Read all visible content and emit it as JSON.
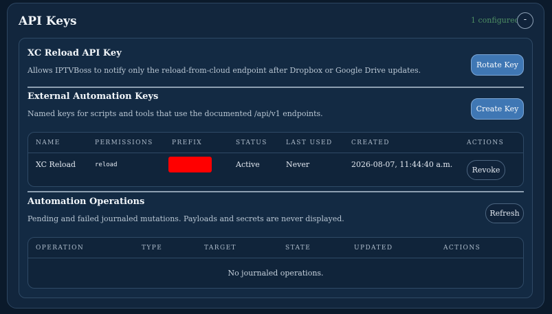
{
  "header": {
    "title": "API Keys",
    "configured_count": "1 configured",
    "collapse_label": "-"
  },
  "reload_section": {
    "title": "XC Reload API Key",
    "description": "Allows IPTVBoss to notify only the reload-from-cloud endpoint after Dropbox or Google Drive updates.",
    "button": "Rotate Key"
  },
  "automation_keys": {
    "title": "External Automation Keys",
    "description": "Named keys for scripts and tools that use the documented /api/v1 endpoints.",
    "button": "Create Key",
    "columns": [
      "NAME",
      "PERMISSIONS",
      "PREFIX",
      "STATUS",
      "LAST USED",
      "CREATED",
      "ACTIONS"
    ],
    "rows": [
      {
        "name": "XC Reload",
        "permissions": "reload",
        "status": "Active",
        "last_used": "Never",
        "created": "2026-08-07, 11:44:40 a.m.",
        "action": "Revoke"
      }
    ]
  },
  "operations": {
    "title": "Automation Operations",
    "description": "Pending and failed journaled mutations. Payloads and secrets are never displayed.",
    "button": "Refresh",
    "columns": [
      "OPERATION",
      "TYPE",
      "TARGET",
      "STATE",
      "UPDATED",
      "ACTIONS"
    ],
    "empty_message": "No journaled operations."
  },
  "colors": {
    "background": "#0b1a2b",
    "primary_button": "#3f77b4",
    "configured_text": "#4e8f63",
    "redaction": "#ff0000"
  }
}
